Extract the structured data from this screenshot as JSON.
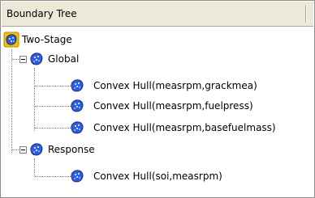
{
  "header": {
    "title": "Boundary Tree"
  },
  "tree": {
    "root": {
      "label": "Two-Stage",
      "icon": "boundary-model-icon"
    },
    "nodes": [
      {
        "label": "Global",
        "icon": "boundary-model-icon",
        "expander": "minus",
        "children": [
          {
            "label": "Convex Hull(measrpm,grackmea)",
            "icon": "boundary-model-icon"
          },
          {
            "label": "Convex Hull(measrpm,fuelpress)",
            "icon": "boundary-model-icon"
          },
          {
            "label": "Convex Hull(measrpm,basefuelmass)",
            "icon": "boundary-model-icon"
          }
        ]
      },
      {
        "label": "Response",
        "icon": "boundary-model-icon",
        "expander": "minus",
        "children": [
          {
            "label": "Convex Hull(soi,measrpm)",
            "icon": "boundary-model-icon"
          }
        ]
      }
    ]
  },
  "colors": {
    "header_bg": "#ece9d8",
    "border": "#8e8e8e",
    "icon_fill": "#2b5fe0",
    "icon_outline": "#1a2a80",
    "root_icon_bg": "#f2c000"
  }
}
